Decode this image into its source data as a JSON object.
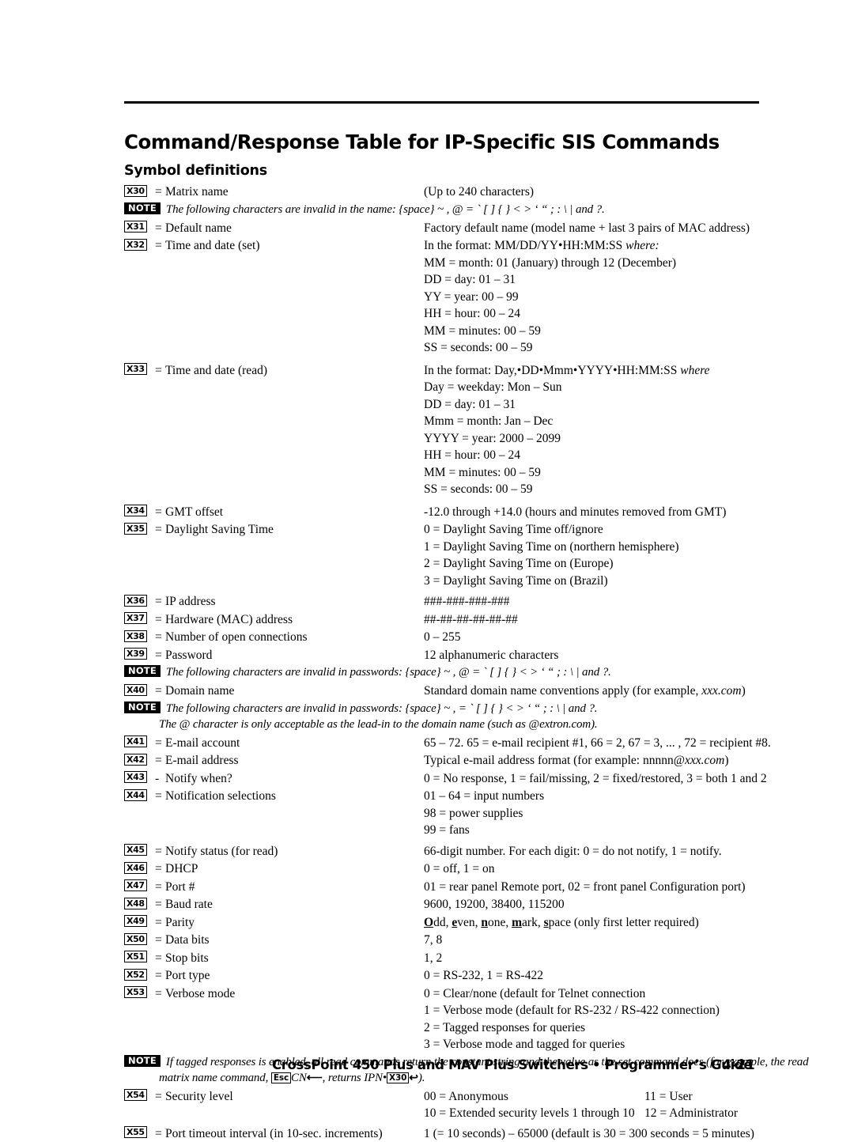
{
  "document": {
    "heading": "Command/Response Table for IP-Specific SIS Commands",
    "subheading": "Symbol definitions"
  },
  "footer": {
    "title": "CrossPoint 450 Plus and MAV Plus Switchers • Programmer’s Guide",
    "page": "4-21"
  },
  "note_label": "NOTE",
  "rows": [
    {
      "badge": "X30",
      "sep": "=",
      "symbol": "Matrix name",
      "values": [
        "(Up to 240 characters)"
      ]
    },
    {
      "badge": "X31",
      "sep": "=",
      "symbol": "Default name",
      "values": [
        "Factory default name (model name + last 3 pairs of MAC address)"
      ]
    },
    {
      "badge": "X32",
      "sep": "=",
      "symbol": "Time and date (set)",
      "values": [
        "In the format: MM/DD/YY•HH:MM:SS where:",
        "MM = month: 01 (January) through 12 (December)",
        "DD = day: 01 – 31",
        "YY = year: 00 – 99",
        "HH = hour: 00 – 24",
        "MM = minutes: 00 – 59",
        "SS = seconds: 00 – 59"
      ]
    },
    {
      "badge": "X33",
      "sep": "=",
      "symbol": "Time and date (read)",
      "values": [
        "In the format: Day,•DD•Mmm•YYYY•HH:MM:SS where",
        "Day = weekday: Mon – Sun",
        "DD = day: 01 – 31",
        "Mmm = month: Jan – Dec",
        "YYYY = year: 2000 – 2099",
        "HH = hour: 00 – 24",
        "MM = minutes: 00 – 59",
        "SS = seconds: 00 – 59"
      ]
    },
    {
      "badge": "X34",
      "sep": "=",
      "symbol": "GMT offset",
      "values": [
        "-12.0 through +14.0 (hours and minutes removed from GMT)"
      ]
    },
    {
      "badge": "X35",
      "sep": "=",
      "symbol": "Daylight Saving Time",
      "values": [
        "0 = Daylight Saving Time off/ignore",
        "1 = Daylight Saving Time on (northern hemisphere)",
        "2 = Daylight Saving Time on (Europe)",
        "3 = Daylight Saving Time on (Brazil)"
      ]
    },
    {
      "badge": "X36",
      "sep": "=",
      "symbol": "IP address",
      "values": [
        "###-###-###-###"
      ]
    },
    {
      "badge": "X37",
      "sep": "=",
      "symbol": "Hardware (MAC) address",
      "values": [
        "##-##-##-##-##-##"
      ]
    },
    {
      "badge": "X38",
      "sep": "=",
      "symbol": "Number of open connections",
      "values": [
        "0 – 255"
      ]
    },
    {
      "badge": "X39",
      "sep": "=",
      "symbol": "Password",
      "values": [
        "12 alphanumeric characters"
      ]
    },
    {
      "badge": "X40",
      "sep": "=",
      "symbol": "Domain name",
      "values": [
        "Standard domain name conventions apply (for example, xxx.com)"
      ]
    },
    {
      "badge": "X41",
      "sep": "=",
      "symbol": "E-mail account",
      "values": [
        "65 – 72.  65 = e-mail recipient #1, 66 = 2, 67 = 3, ... , 72 = recipient #8."
      ]
    },
    {
      "badge": "X42",
      "sep": "=",
      "symbol": "E-mail address",
      "values": [
        "Typical e-mail address format (for example: nnnnn@xxx.com)"
      ]
    },
    {
      "badge": "X43",
      "sep": "-",
      "symbol": "Notify when?",
      "values": [
        "0 = No response, 1 = fail/missing, 2 = fixed/restored, 3 = both 1 and 2"
      ]
    },
    {
      "badge": "X44",
      "sep": "=",
      "symbol": "Notification selections",
      "values": [
        "01 – 64 = input numbers",
        "98 = power supplies",
        "99 = fans"
      ]
    },
    {
      "badge": "X45",
      "sep": "=",
      "symbol": "Notify status (for read)",
      "values": [
        "66-digit number.  For each digit: 0 = do not notify, 1 = notify."
      ]
    },
    {
      "badge": "X46",
      "sep": "=",
      "symbol": "DHCP",
      "values": [
        "0 = off, 1 = on"
      ]
    },
    {
      "badge": "X47",
      "sep": "=",
      "symbol": "Port #",
      "values": [
        "01 = rear panel Remote port, 02 =  front panel Configuration port)"
      ]
    },
    {
      "badge": "X48",
      "sep": "=",
      "symbol": "Baud rate",
      "values": [
        "9600, 19200, 38400, 115200"
      ]
    },
    {
      "badge": "X49",
      "sep": "=",
      "symbol": "Parity",
      "values": [
        "Odd, even, none, mark, space (only first letter required)"
      ]
    },
    {
      "badge": "X50",
      "sep": "=",
      "symbol": "Data bits",
      "values": [
        "7, 8"
      ]
    },
    {
      "badge": "X51",
      "sep": "=",
      "symbol": "Stop bits",
      "values": [
        "1, 2"
      ]
    },
    {
      "badge": "X52",
      "sep": "=",
      "symbol": "Port type",
      "values": [
        "0 = RS-232, 1 = RS-422"
      ]
    },
    {
      "badge": "X53",
      "sep": "=",
      "symbol": "Verbose mode",
      "values": [
        "0 = Clear/none (default for Telnet connection",
        "1 = Verbose mode (default for RS-232 / RS-422 connection)",
        "2 = Tagged responses for queries",
        "3 = Verbose mode and tagged for queries"
      ]
    },
    {
      "badge": "X54",
      "sep": "=",
      "symbol": "Security level",
      "values": [
        "00 = Anonymous",
        "10 = Extended security levels 1 through 10"
      ],
      "values2": [
        "11 = User",
        "12 = Administrator"
      ]
    },
    {
      "badge": "X55",
      "sep": "=",
      "symbol": "Port timeout interval (in 10-sec. increments)",
      "values": [
        "1 (= 10 seconds) – 65000 (default is 30 = 300 seconds = 5 minutes)"
      ]
    }
  ],
  "notes": {
    "name_invalid": "The following characters are invalid in the name: {space} ~ , @ = ` [ ] { } < > ‘ “ ; : \\ |  and  ?.",
    "password_invalid": "The following characters are invalid in passwords: {space} ~ , @ = ` [ ] { } < > ‘ “ ; : \\ |  and  ?.",
    "domain_invalid": "The following characters are invalid in passwords: {space} ~ , = ` [ ] { } < > ‘ “ ; : \\ |  and  ?.",
    "domain_invalid_line2": "The @ character is only acceptable as the lead-in to the domain name (such as @extron.com).",
    "tagged_line1": "If tagged responses is enabled, all read commands return the constant string and the value as the set command does (for example, the read",
    "tagged_line2_a": "matrix name command, ",
    "tagged_esc": "Esc",
    "tagged_line2_b": "CN",
    "tagged_line2_c": ", returns IPN•",
    "tagged_x30": "X30",
    "tagged_line2_d": ")."
  },
  "parity_underlined": [
    "O",
    "e",
    "n",
    "m",
    "s"
  ]
}
